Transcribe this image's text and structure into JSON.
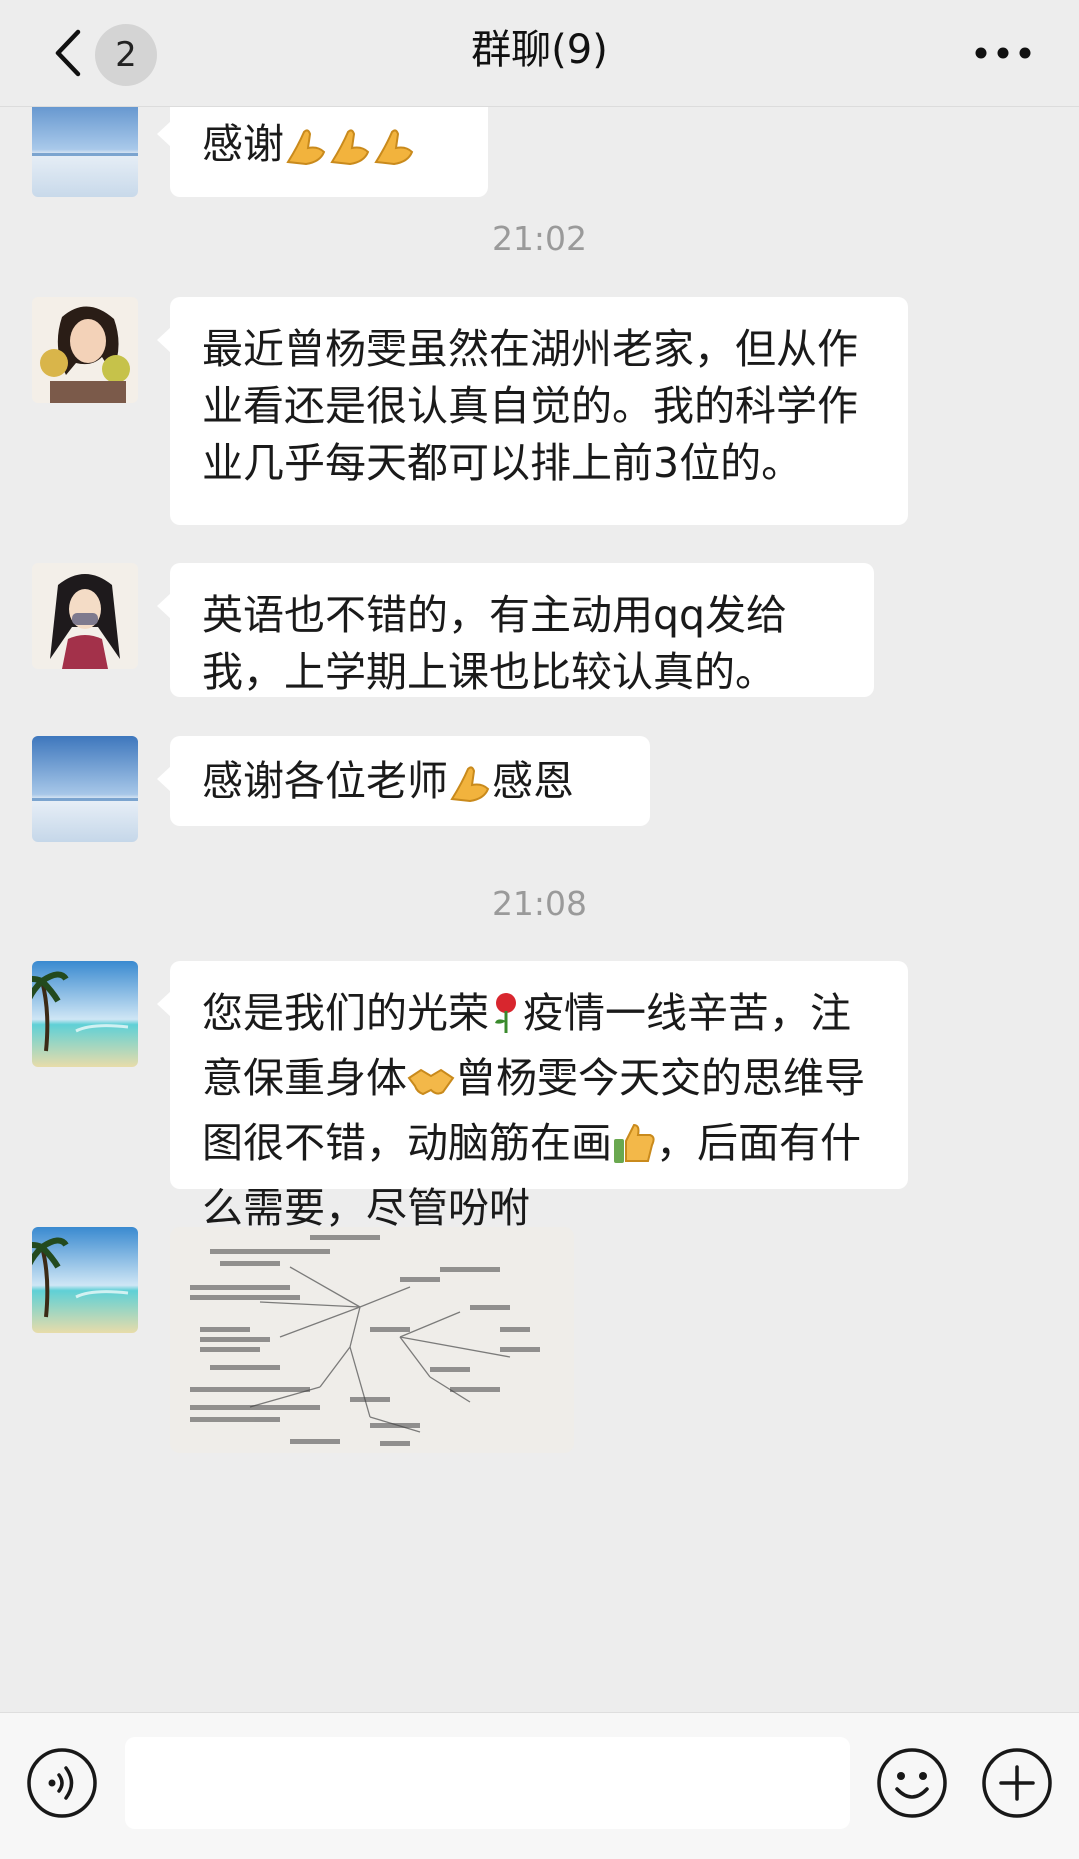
{
  "header": {
    "unread_count": "2",
    "title": "群聊(9)"
  },
  "messages": {
    "m1": {
      "text": "感谢",
      "emoji": [
        "folded-hands",
        "folded-hands",
        "folded-hands"
      ]
    },
    "time1": "21:02",
    "m2": {
      "text": "最近曾杨雯虽然在湖州老家，但从作业看还是很认真自觉的。我的科学作业几乎每天都可以排上前3位的。"
    },
    "m3": {
      "text": "英语也不错的，有主动用qq发给我，上学期上课也比较认真的。"
    },
    "m4": {
      "text_before": "感谢各位老师",
      "emoji": "folded-hands",
      "text_after": "感恩"
    },
    "time2": "21:08",
    "m5": {
      "part1": "您是我们的光荣",
      "emoji1": "rose",
      "part2": "疫情一线辛苦，注意保重身体",
      "emoji2": "handshake",
      "part3": "曾杨雯今天交的思维导图很不错，动脑筋在画",
      "emoji3": "thumbs-up",
      "part4": "，后面有什么需要，尽管吩咐"
    },
    "m6": {
      "type": "image",
      "description_icon": "mind-map-photo"
    }
  },
  "input": {
    "placeholder": ""
  },
  "colors": {
    "background": "#ededed",
    "bubble": "#ffffff",
    "timestamp": "#9a9a9a"
  }
}
